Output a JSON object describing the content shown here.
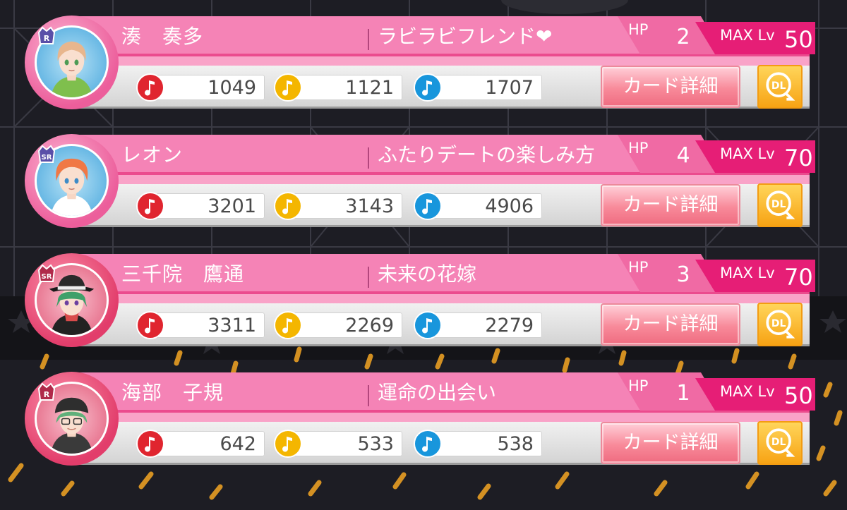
{
  "labels": {
    "hp": "HP",
    "max_lv": "MAX Lv",
    "detail_button": "カード詳細",
    "download_button": "DL"
  },
  "colors": {
    "band": "#f583b6",
    "level_tab": "#e61e76",
    "note_red": "#e0252f",
    "note_yellow": "#f4b600",
    "note_blue": "#1896dc"
  },
  "icons": {
    "attribute_1": "music-note-red-icon",
    "attribute_2": "music-note-yellow-icon",
    "attribute_3": "music-note-blue-icon",
    "download": "download-icon"
  },
  "cards": [
    {
      "rarity": "R",
      "name": "湊　奏多",
      "title": "ラビラビフレンド❤",
      "hp": "2",
      "max_lv": "50",
      "stats": [
        "1049",
        "1121",
        "1707"
      ]
    },
    {
      "rarity": "SR",
      "name": "レオン",
      "title": "ふたりデートの楽しみ方",
      "hp": "4",
      "max_lv": "70",
      "stats": [
        "3201",
        "3143",
        "4906"
      ]
    },
    {
      "rarity": "SR",
      "name": "三千院　鷹通",
      "title": "未来の花嫁",
      "hp": "3",
      "max_lv": "70",
      "stats": [
        "3311",
        "2269",
        "2279"
      ]
    },
    {
      "rarity": "R",
      "name": "海部　子規",
      "title": "運命の出会い",
      "hp": "1",
      "max_lv": "50",
      "stats": [
        "642",
        "533",
        "538"
      ]
    }
  ]
}
